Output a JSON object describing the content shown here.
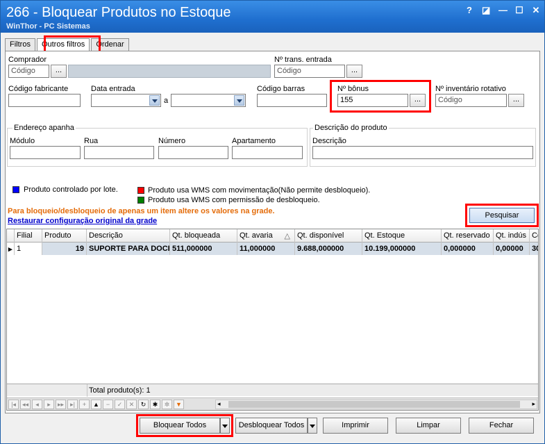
{
  "window": {
    "title": "266 - Bloquear Produtos no Estoque",
    "subtitle": "WinThor - PC Sistemas",
    "controls": [
      "?",
      "◪",
      "—",
      "☐",
      "✕"
    ]
  },
  "tabs": [
    {
      "label": "Filtros",
      "underline": "F"
    },
    {
      "label": "Outros filtros",
      "underline": "u",
      "active": true
    },
    {
      "label": "Ordenar",
      "underline": "O"
    }
  ],
  "filters": {
    "comprador": {
      "label": "Comprador",
      "placeholder": "Código",
      "btn": "..."
    },
    "trans_entrada": {
      "label": "Nº trans. entrada",
      "placeholder": "Código",
      "btn": "..."
    },
    "codigo_fabricante": {
      "label": "Código fabricante",
      "value": ""
    },
    "data_entrada": {
      "label": "Data entrada",
      "separator": "a"
    },
    "codigo_barras": {
      "label": "Código barras",
      "value": ""
    },
    "bonus": {
      "label": "Nº bônus",
      "value": "155",
      "btn": "..."
    },
    "inventario": {
      "label": "Nº inventário rotativo",
      "placeholder": "Código",
      "btn": "..."
    }
  },
  "endereco": {
    "title": "Endereço apanha",
    "fields": [
      "Módulo",
      "Rua",
      "Número",
      "Apartamento"
    ]
  },
  "descricao_produto": {
    "title": "Descrição do produto",
    "label": "Descrição"
  },
  "legend": {
    "items": [
      {
        "text": "Produto controlado por lote.",
        "color": "#0000ff"
      },
      {
        "text": "Produto usa WMS com movimentação(Não permite desbloqueio).",
        "color": "#ff0000"
      },
      {
        "text": "Produto usa WMS com permissão de desbloqueio.",
        "color": "#008000"
      }
    ]
  },
  "hint": "Para bloqueio/desbloqueio de apenas um item altere os valores na grade.",
  "restore_link": "Restaurar configuração original da grade",
  "search_button": "Pesquisar",
  "grid": {
    "headers": [
      "Filial",
      "Produto",
      "Descrição",
      "Qt. bloqueada",
      "Qt. avaria",
      "Qt. disponível",
      "Qt. Estoque",
      "Qt. reservado",
      "Qt. indús",
      "Có"
    ],
    "sort_indicator": "△",
    "rows": [
      [
        "1",
        "19",
        "SUPORTE PARA DOCI",
        "511,000000",
        "11,000000",
        "9.688,000000",
        "10.199,000000",
        "0,000000",
        "0,00000",
        "30"
      ]
    ],
    "footer": "Total produto(s): 1"
  },
  "buttons": {
    "bloquear": "Bloquear Todos",
    "desbloquear": "Desbloquear Todos",
    "imprimir": "Imprimir",
    "limpar": "Limpar",
    "fechar": "Fechar"
  }
}
